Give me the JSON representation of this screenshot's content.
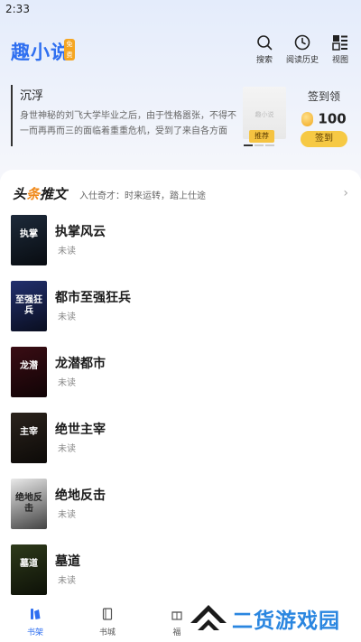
{
  "status_bar": {
    "time": "2:33"
  },
  "header": {
    "logo": "趣小说",
    "logo_tag": "免费",
    "search_label": "搜索",
    "history_label": "阅读历史",
    "view_label": "视图"
  },
  "banner": {
    "title": "沉浮",
    "description": "身世神秘的刘飞大学毕业之后，由于性格嚣张，不得不一而再再而三的面临着重重危机，受到了来自各方面的…",
    "cover_placeholder": "趣小说",
    "tag": "推荐"
  },
  "signin": {
    "title": "签到领",
    "coins": "100",
    "button": "签到"
  },
  "section": {
    "title_part1": "头",
    "title_accent": "条",
    "title_part2": "推文",
    "subtitle": "入仕奇才：时来运转，踏上仕途"
  },
  "books": [
    {
      "title": "执掌风云",
      "status": "未读",
      "cover_text": "执掌",
      "cover_color": "#1d2a3a"
    },
    {
      "title": "都市至强狂兵",
      "status": "未读",
      "cover_text": "至强狂兵",
      "cover_color": "#22306e"
    },
    {
      "title": "龙潜都市",
      "status": "未读",
      "cover_text": "龙潜",
      "cover_color": "#3a0d14"
    },
    {
      "title": "绝世主宰",
      "status": "未读",
      "cover_text": "主宰",
      "cover_color": "#2b231c"
    },
    {
      "title": "绝地反击",
      "status": "未读",
      "cover_text": "绝地反击",
      "cover_color": "#e9e9e9"
    },
    {
      "title": "墓道",
      "status": "未读",
      "cover_text": "墓道",
      "cover_color": "#2e3a1a"
    }
  ],
  "bottom_nav": [
    {
      "label": "书架",
      "icon": "bookshelf-icon",
      "active": true
    },
    {
      "label": "书城",
      "icon": "book-icon",
      "active": false
    },
    {
      "label": "福",
      "icon": "gift-icon",
      "active": false
    }
  ],
  "watermark": {
    "text": "二货游戏园"
  },
  "colors": {
    "accent": "#2f6ff0",
    "gold": "#f6c944",
    "orange": "#f08a1c"
  }
}
